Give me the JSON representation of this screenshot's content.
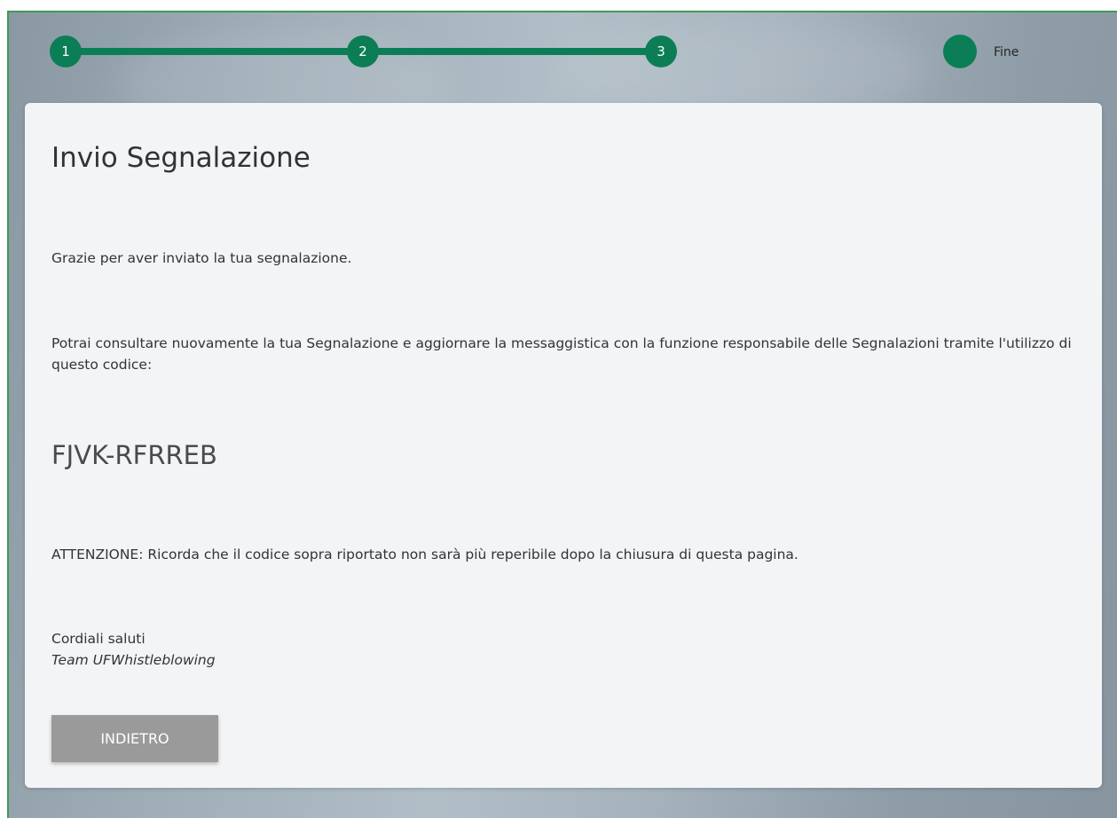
{
  "stepper": {
    "steps": [
      "1",
      "2",
      "3"
    ],
    "end_label": "Fine",
    "accent_color": "#0b7e55"
  },
  "card": {
    "title": "Invio Segnalazione",
    "thanks": "Grazie per aver inviato la tua segnalazione.",
    "info": "Potrai consultare nuovamente la tua Segnalazione e aggiornare la messaggistica con la funzione responsabile delle Segnalazioni tramite l'utilizzo di questo codice:",
    "code": "FJVK-RFRREB",
    "warning": "ATTENZIONE: Ricorda che il codice sopra riportato non sarà più reperibile dopo la chiusura di questa pagina.",
    "greeting": "Cordiali saluti",
    "team": "Team UFWhistleblowing",
    "back_button": "INDIETRO"
  }
}
